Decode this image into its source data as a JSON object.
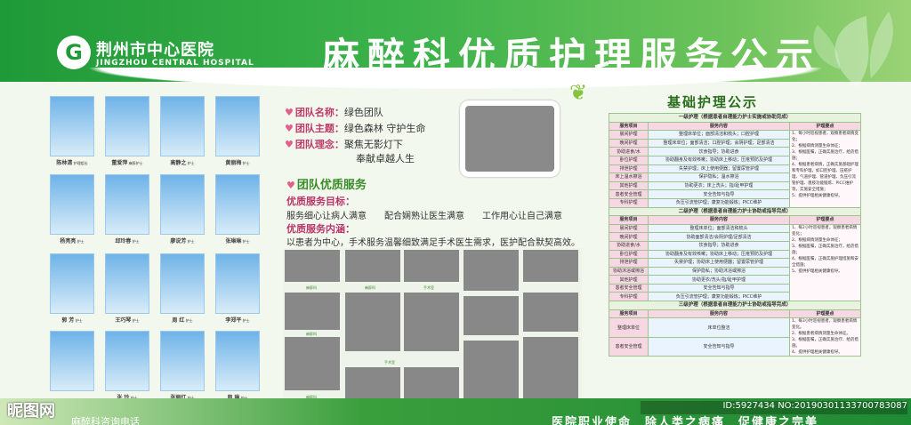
{
  "header": {
    "logo_glyph": "G",
    "hospital_name": "荆州市中心医院",
    "hospital_en": "JINGZHOU CENTRAL HOSPITAL",
    "title": "麻醉科优质护理服务公示"
  },
  "staff": [
    {
      "name": "陈林清",
      "role": "护理组长"
    },
    {
      "name": "董爱萍",
      "role": "麻醉护士"
    },
    {
      "name": "高静之",
      "role": "护士"
    },
    {
      "name": "黄丽梅",
      "role": "护士"
    },
    {
      "name": "杨亮亮",
      "role": "护士"
    },
    {
      "name": "邱玲春",
      "role": "护士"
    },
    {
      "name": "廖说芳",
      "role": "护士"
    },
    {
      "name": "张琳琳",
      "role": "护士"
    },
    {
      "name": "郭 芳",
      "role": "护士"
    },
    {
      "name": "王巧琴",
      "role": "护士"
    },
    {
      "name": "周 红",
      "role": "护士"
    },
    {
      "name": "李郑平",
      "role": "护士"
    },
    {
      "name": "",
      "role": ""
    },
    {
      "name": "张 玲",
      "role": "护士"
    },
    {
      "name": "张丽红",
      "role": "护士"
    },
    {
      "name": "周 琳",
      "role": "护士"
    }
  ],
  "team": {
    "name_label": "团队名称：",
    "name_value": "绿色团队",
    "theme_label": "团队主题：",
    "theme_value": "绿色森林 守护生命",
    "concept_label": "团队理念：",
    "concept_value_1": "聚焦无影灯下",
    "concept_value_2": "奉献卓越人生",
    "service_title": "团队优质服务",
    "goal_label": "优质服务目标：",
    "goal_text": "服务细心让病人满意　　配合娴熟让医生满意　　工作用心让自己满意",
    "content_label": "优质服务内涵：",
    "content_text": "以患者为中心，手术服务温馨细致满足手术医生需求，医护配合默契高效。"
  },
  "collage_captions": [
    "麻醉科",
    "麻醉科",
    "手术室",
    "麻醉科",
    "麻醉科",
    "麻醉科",
    "手术室",
    "麻醉科"
  ],
  "care": {
    "title": "基础护理公示",
    "col_item": "服务项目",
    "col_content": "服务内容",
    "col_points": "护理要点",
    "levels": [
      {
        "label": "一级护理（根据患者自理能力护士实施或协助完成）",
        "rows": [
          {
            "item": "晨间护理",
            "content": "整理床单位；面部清洁和梳头；口腔护理"
          },
          {
            "item": "晚间护理",
            "content": "整理床单位；面部清洁；口腔护理；会阴护理；足部清洁"
          },
          {
            "item": "协助进食/水",
            "content": "饮食指导；协助进食"
          },
          {
            "item": "卧位护理",
            "content": "协助翻身及有效咳嗽；协助床上移动；压疮预防及护理"
          },
          {
            "item": "排泄护理",
            "content": "失禁护理；床上使用便器；留置尿管护理"
          },
          {
            "item": "床上温水擦浴",
            "content": "保护隐私；温水擦浴"
          },
          {
            "item": "其他护理",
            "content": "协助更衣；床上洗头；指/趾甲护理"
          },
          {
            "item": "患者安全管理",
            "content": "安全告知与指导"
          },
          {
            "item": "专科护理",
            "content": "负压引流管护理；康复功能锻炼；PICC维护"
          }
        ],
        "points": [
          "1、每小时巡视患者，观察患者病情变化；",
          "2、根据病情测量生命体征；",
          "3、根据医嘱，正确实施治疗，给药措施；",
          "4、根据患者病情，正确实施基础护理和专科护理，如口腔护理、压疮护理、气道护理、管道护理、负压引流管护理、患肢功能锻炼、PICC维护等，实施安全措施；",
          "5、提供护理相关健康指导。"
        ]
      },
      {
        "label": "二级护理（根据患者自理能力护士协助或指导完成）",
        "rows": [
          {
            "item": "晨间护理",
            "content": "整理床单位；面部清洁和梳头"
          },
          {
            "item": "晚间护理",
            "content": "协助面部清洁/会阴护理/足部清洁"
          },
          {
            "item": "协助进食/水",
            "content": "饮食指导；协助进食"
          },
          {
            "item": "卧位护理",
            "content": "协助翻身及有效咳嗽；协助床上移动；压疮预防及护理"
          },
          {
            "item": "排泄护理",
            "content": "失禁护理；协助床上使用便器；留置尿管护理"
          },
          {
            "item": "协助沐浴或擦浴",
            "content": "保护隐私；协助沐浴或擦浴"
          },
          {
            "item": "其他护理",
            "content": "协助更衣/洗头/指/趾甲护理"
          },
          {
            "item": "患者安全管理",
            "content": "安全告知与指导"
          },
          {
            "item": "专科护理",
            "content": "负压引流管护理；康复功能锻炼；PICC维护"
          }
        ],
        "points": [
          "1、每2小时巡视患者，观察患者病情变化；",
          "2、根据病情测量生命体征；",
          "3、根据医嘱，正确实施治疗，给药措施；",
          "4、根据医嘱，正确实施护理措施和安全措施；",
          "5、提供护理相关健康指导。"
        ]
      },
      {
        "label": "三级护理（根据患者自理能力护士协助或指导完成）",
        "rows": [
          {
            "item": "整理床单位",
            "content": "床单位整洁"
          },
          {
            "item": "患者安全管理",
            "content": "安全告知与指导"
          }
        ],
        "points": [
          "1、每3小时巡视患者，观察患者病情变化。",
          "2、根据患者病情测量生命体征。",
          "3、根据医嘱，正确实施治疗、给药措施。",
          "4、提供护理相关健康指导。"
        ]
      }
    ]
  },
  "footer": {
    "left_text": "麻醉科咨询电话",
    "mission": "医院职业使命　除人类之病痛　促健康之完美"
  },
  "watermarks": {
    "site": "昵图网",
    "id_text": "ID:5927434 NO:20190301133700783087"
  },
  "colors": {
    "brand_green": "#1f9a38",
    "accent_pink": "#c03a6a",
    "table_border": "#9dc38e"
  }
}
